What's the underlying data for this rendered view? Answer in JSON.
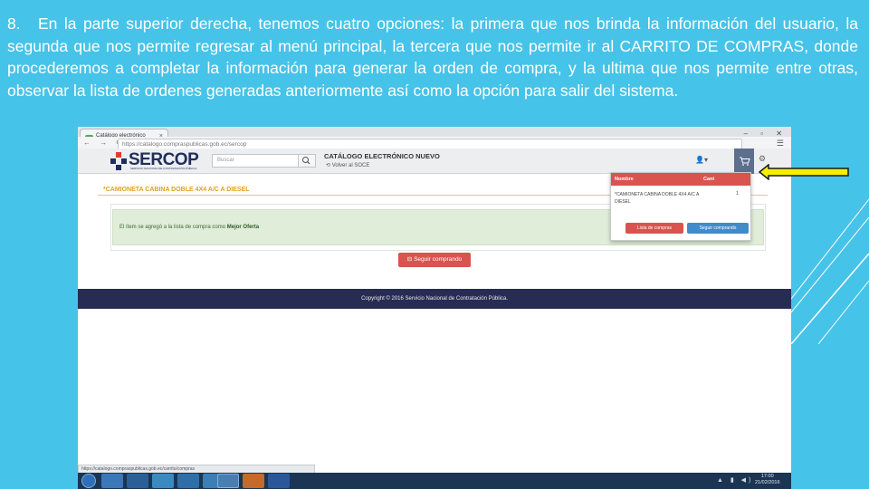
{
  "slide": {
    "step_number": "8.",
    "instruction": "En la parte superior derecha, tenemos cuatro opciones: la primera que nos brinda la información del usuario, la segunda que nos permite regresar al menú principal, la tercera que nos permite ir al CARRITO DE COMPRAS, donde procederemos a completar la información para generar la orden de compra, y la ultima que nos permite entre otras, observar la lista de ordenes generadas anteriormente así como la opción para salir del sistema."
  },
  "browser": {
    "tab_title": "Catálogo electrónico",
    "tab_close": "×",
    "url": "https://catalogo.compraspublicas.gob.ec/sercop",
    "status_url": "https://catalogo.compraspublicas.gob.ec/carrito/compras"
  },
  "site": {
    "logo_text": "SERCOP",
    "logo_subtitle": "SERVICIO NACIONAL DE CONTRATACIÓN PÚBLICA",
    "search_placeholder": "Buscar",
    "catalog_title": "CATÁLOGO ELECTRÓNICO NUEVO",
    "back_link": "⟲ Volver al SOCE",
    "product_title": "*CAMIONETA CABINA DOBLE 4X4 A/C A DIESEL",
    "alert_text": "El ítem se agregó a la lista de compra como ",
    "alert_bold": "Mejor Oferta",
    "continue_button": "Seguir comprando",
    "footer_text": "Copyright © 2016 Servicio Nacional de Contratación Pública."
  },
  "cart_dropdown": {
    "col_name": "Nombre",
    "col_qty": "Cant",
    "item_name": "*CAMIONETA CABINA DOBLE 4X4 A/C A DIESEL",
    "item_qty": "1",
    "list_button": "Lista de compras",
    "continue_button": "Seguir comprando"
  },
  "taskbar": {
    "time": "17:00",
    "date": "21/02/2016"
  },
  "colors": {
    "slide_bg": "#46c3e8",
    "brand_navy": "#1f2e5a",
    "accent_red": "#d9534f",
    "accent_blue": "#428bca",
    "arrow_yellow": "#f5f000"
  }
}
